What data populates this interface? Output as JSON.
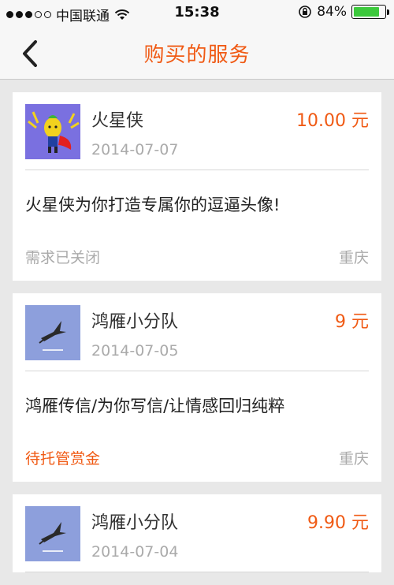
{
  "status_bar": {
    "carrier": "中国联通",
    "time": "15:38",
    "battery": "84%",
    "battery_level": 0.84,
    "signal_bars": 5,
    "signal_filled": 3
  },
  "nav": {
    "title": "购买的服务",
    "back_icon": "chevron-left-icon"
  },
  "services": [
    {
      "name": "火星侠",
      "date": "2014-07-07",
      "price": "10.00 元",
      "description": "火星侠为你打造专属你的逗逼头像!",
      "status": "需求已关闭",
      "city": "重庆"
    },
    {
      "name": "鸿雁小分队",
      "date": "2014-07-05",
      "price": "9 元",
      "description": "鸿雁传信/为你写信/让情感回归纯粹",
      "status": "待托管赏金",
      "city": "重庆"
    },
    {
      "name": "鸿雁小分队",
      "date": "2014-07-04",
      "price": "9.90 元",
      "description": "",
      "status": "",
      "city": ""
    }
  ],
  "colors": {
    "accent": "#f05a14",
    "muted": "#aaaaaa",
    "background": "#e8e8e8",
    "battery": "#3cc93c"
  }
}
